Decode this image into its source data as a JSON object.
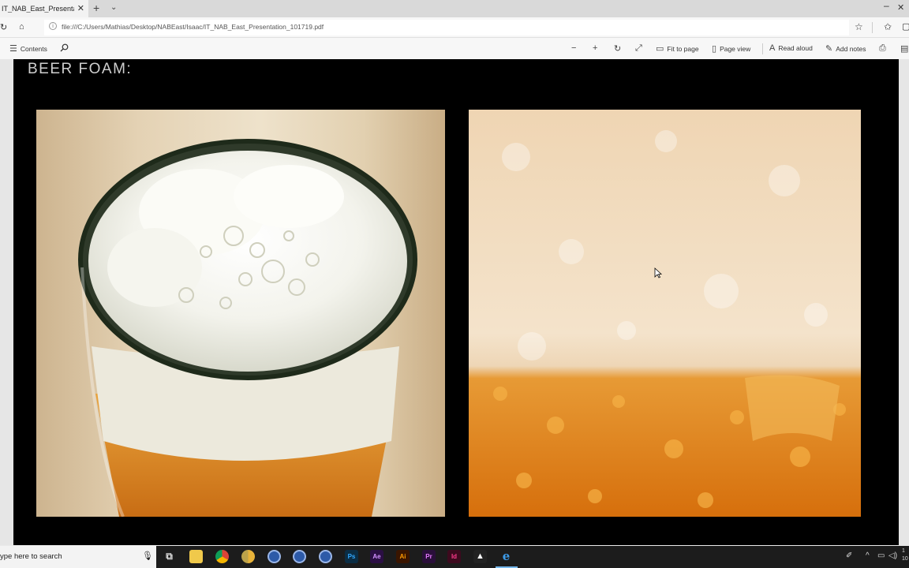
{
  "browser": {
    "tab_title": "IT_NAB_East_Presentatio",
    "url": "file:///C:/Users/Mathias/Desktop/NABEast/Isaac/IT_NAB_East_Presentation_101719.pdf"
  },
  "pdf_toolbar": {
    "contents_label": "Contents",
    "fit_to_page_label": "Fit to page",
    "page_view_label": "Page view",
    "read_aloud_label": "Read aloud",
    "add_notes_label": "Add notes"
  },
  "slide": {
    "title": "BEER FOAM:"
  },
  "taskbar": {
    "search_placeholder": "ype here to search",
    "clock_time": "1",
    "clock_date": "10",
    "apps": [
      {
        "name": "file-explorer-icon",
        "label": ""
      },
      {
        "name": "chrome-icon",
        "label": ""
      },
      {
        "name": "chrome-canary-icon",
        "label": ""
      },
      {
        "name": "browser-icon-1",
        "label": ""
      },
      {
        "name": "browser-icon-2",
        "label": ""
      },
      {
        "name": "browser-icon-3",
        "label": ""
      },
      {
        "name": "photoshop-icon",
        "label": "Ps"
      },
      {
        "name": "after-effects-icon",
        "label": "Ae"
      },
      {
        "name": "illustrator-icon",
        "label": "Ai"
      },
      {
        "name": "premiere-icon",
        "label": "Pr"
      },
      {
        "name": "indesign-icon",
        "label": "Id"
      },
      {
        "name": "photos-icon",
        "label": ""
      },
      {
        "name": "edge-icon",
        "label": "e"
      }
    ]
  },
  "colors": {
    "slide_bg": "#000000",
    "taskbar_bg": "#1c1c1c",
    "photoshop": "#0b2d44",
    "after_effects": "#2b0f44",
    "illustrator": "#3a1500",
    "premiere": "#2a0f3a",
    "indesign": "#3d0a1e",
    "edge_blue": "#1f7ad6"
  }
}
